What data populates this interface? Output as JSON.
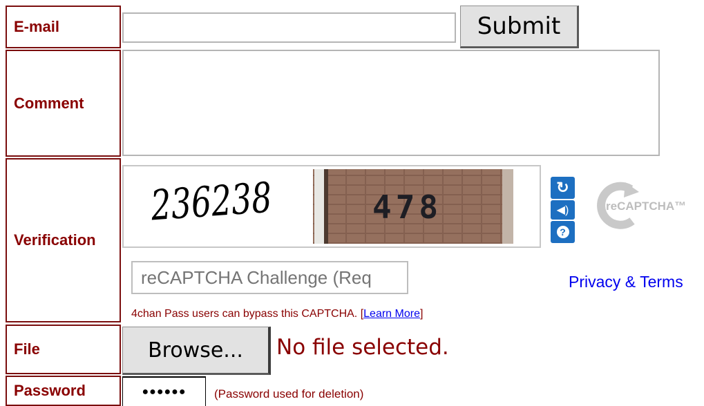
{
  "labels": {
    "email": "E-mail",
    "comment": "Comment",
    "verification": "Verification",
    "file": "File",
    "password": "Password"
  },
  "email_field": {
    "value": ""
  },
  "comment_field": {
    "value": ""
  },
  "submit_label": "Submit",
  "captcha": {
    "word1": "236238",
    "word2": "478",
    "challenge_placeholder": "reCAPTCHA Challenge (Req",
    "privacy_link": "Privacy & Terms",
    "logo_text": "reCAPTCHA™",
    "pass_notice": "4chan Pass users can bypass this CAPTCHA. [",
    "learn_more": "Learn More",
    "pass_notice_end": "]"
  },
  "file": {
    "browse_label": "Browse...",
    "status": "No file selected."
  },
  "password": {
    "masked": "●●●●●●",
    "note": "(Password used for deletion)"
  },
  "icons": [
    "refresh-icon",
    "audio-icon",
    "help-icon",
    "recaptcha-logo-icon"
  ],
  "colors": {
    "label_text": "#890000",
    "label_border": "#7a0d0d",
    "link": "#0000ee",
    "recaptcha_blue": "#1d6fc1"
  }
}
